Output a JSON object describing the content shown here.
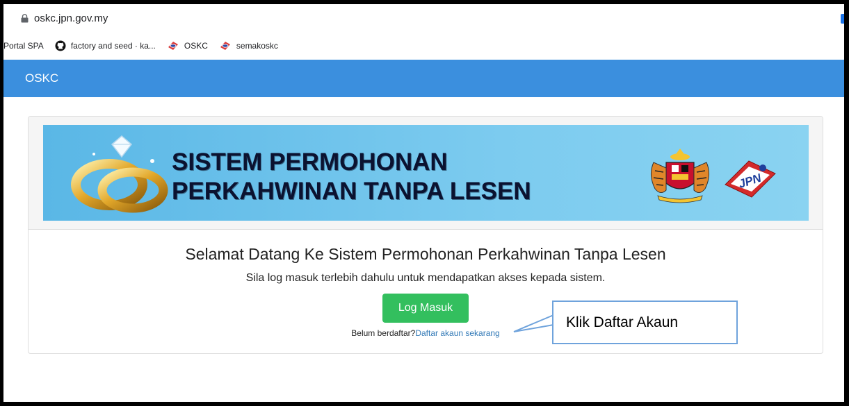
{
  "browser": {
    "url": "oskc.jpn.gov.my",
    "bookmarks": [
      {
        "label": "Portal SPA",
        "icon": "none"
      },
      {
        "label": "factory and seed · ka...",
        "icon": "github-icon"
      },
      {
        "label": "OSKC",
        "icon": "jpn-favicon"
      },
      {
        "label": "semakoskc",
        "icon": "jpn-favicon"
      }
    ]
  },
  "navbar": {
    "brand": "OSKC"
  },
  "banner": {
    "line1": "SISTEM PERMOHONAN",
    "line2": "PERKAHWINAN TANPA LESEN"
  },
  "main": {
    "welcome": "Selamat Datang Ke Sistem Permohonan Perkahwinan Tanpa Lesen",
    "subtitle": "Sila log masuk terlebih dahulu untuk mendapatkan akses kepada sistem.",
    "login_button": "Log Masuk",
    "register_prompt": "Belum berdaftar?",
    "register_link": "Daftar akaun sekarang"
  },
  "annotation": {
    "callout": "Klik Daftar Akaun"
  },
  "colors": {
    "navbar": "#3b8fde",
    "button": "#33bf5e",
    "link": "#337ab7"
  }
}
